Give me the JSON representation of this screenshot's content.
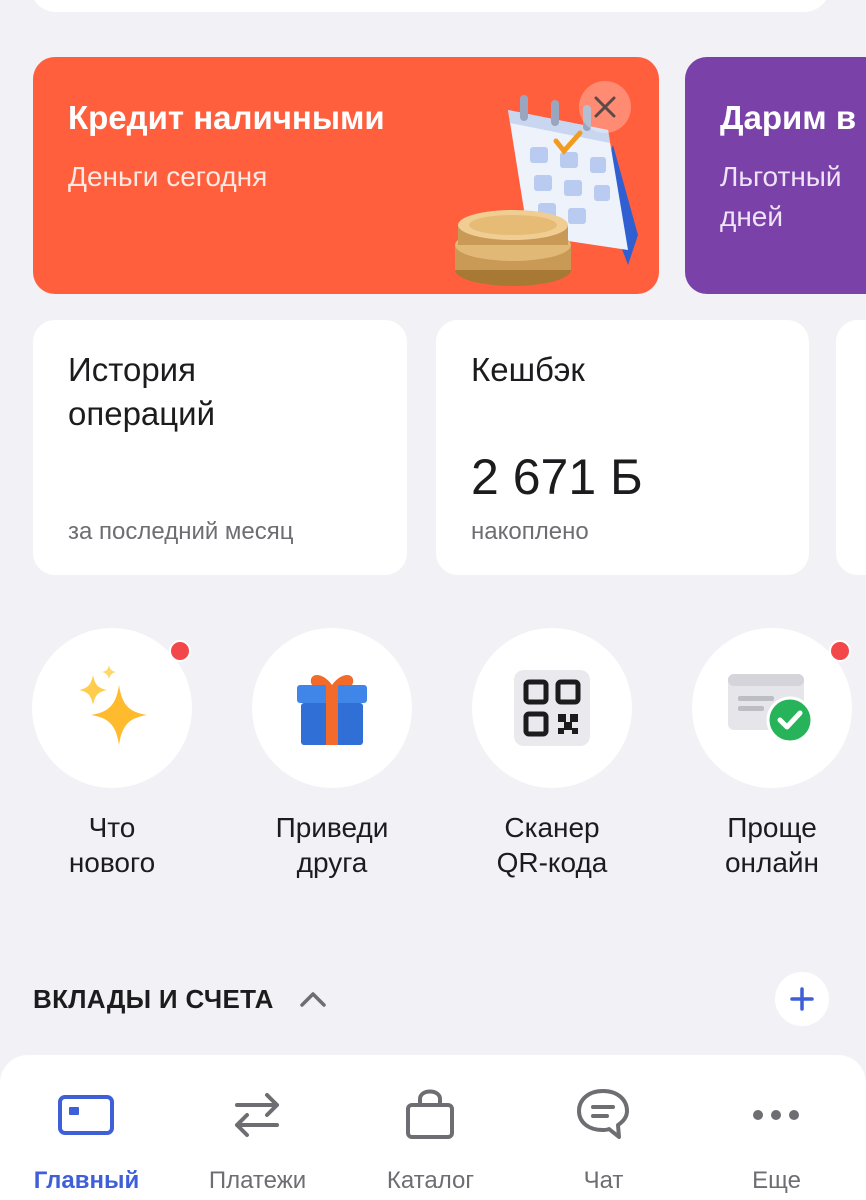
{
  "promos": [
    {
      "title": "Кредит наличными",
      "subtitle": "Деньги сегодня",
      "color": "#ff5f3c"
    },
    {
      "title": "Дарим в",
      "subtitle_lines": [
        "Льготный",
        "дней"
      ],
      "color": "#7a42a8"
    }
  ],
  "tiles": {
    "history": {
      "title_lines": [
        "История",
        "операций"
      ],
      "caption": "за последний месяц"
    },
    "cashback": {
      "title": "Кешбэк",
      "value": "2 671 Б",
      "caption": "накоплено"
    }
  },
  "stories": [
    {
      "label_lines": [
        "Что",
        "нового"
      ],
      "icon": "sparkles-icon",
      "unread": true
    },
    {
      "label_lines": [
        "Приведи",
        "друга"
      ],
      "icon": "gift-icon",
      "unread": false
    },
    {
      "label_lines": [
        "Сканер",
        "QR-кода"
      ],
      "icon": "qr-code-icon",
      "unread": false
    },
    {
      "label_lines": [
        "Проще",
        "онлайн"
      ],
      "icon": "document-check-icon",
      "unread": true
    }
  ],
  "section": {
    "title": "ВКЛАДЫ И СЧЕТА"
  },
  "tabbar": {
    "items": [
      {
        "label": "Главный",
        "icon": "card-icon",
        "active": true
      },
      {
        "label": "Платежи",
        "icon": "transfer-arrows-icon",
        "active": false
      },
      {
        "label": "Каталог",
        "icon": "shopping-bag-icon",
        "active": false
      },
      {
        "label": "Чат",
        "icon": "chat-bubble-icon",
        "active": false
      },
      {
        "label": "Еще",
        "icon": "more-dots-icon",
        "active": false
      }
    ]
  },
  "colors": {
    "background": "#f2f1f6",
    "accent": "#3f5fd9",
    "promo_orange": "#ff5f3c",
    "promo_purple": "#7a42a8",
    "unread_dot": "#f2484a"
  }
}
